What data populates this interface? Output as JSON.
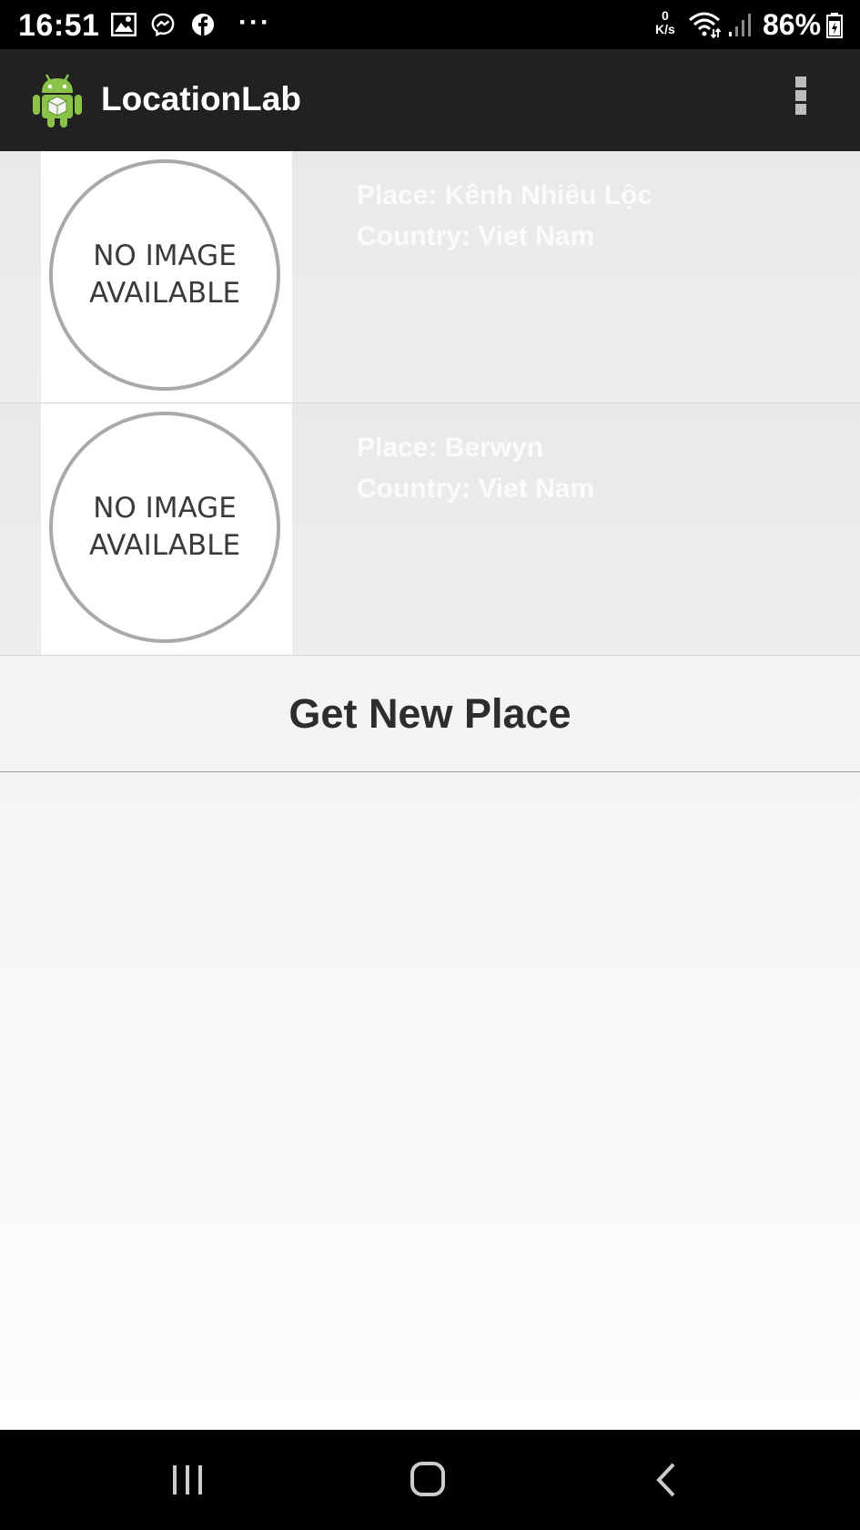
{
  "status_bar": {
    "time": "16:51",
    "net_speed_value": "0",
    "net_speed_unit": "K/s",
    "battery": "86%",
    "icons": [
      "gallery-icon",
      "messenger-icon",
      "facebook-icon",
      "more-notifications-icon",
      "wifi-icon",
      "signal-icon",
      "battery-icon"
    ],
    "more": "···"
  },
  "app_bar": {
    "title": "LocationLab",
    "logo": "android-logo-icon",
    "menu_icon": "overflow-menu-icon"
  },
  "places": [
    {
      "image_text_line1": "NO IMAGE",
      "image_text_line2": "AVAILABLE",
      "place": "Place: Kênh Nhiêu Lộc",
      "country": "Country: Viet Nam"
    },
    {
      "image_text_line1": "NO IMAGE",
      "image_text_line2": "AVAILABLE",
      "place": "Place: Berwyn",
      "country": "Country: Viet Nam"
    }
  ],
  "footer": {
    "get_new_place_label": "Get New Place"
  },
  "nav_bar": {
    "recents_icon": "recents-icon",
    "home_icon": "home-icon",
    "back_icon": "back-icon"
  },
  "colors": {
    "status_bar_bg": "#000000",
    "app_bar_bg": "#212121",
    "list_item_bg": "#ececec",
    "item_text": "#fbfbfb",
    "button_text": "#2d2d2d"
  }
}
